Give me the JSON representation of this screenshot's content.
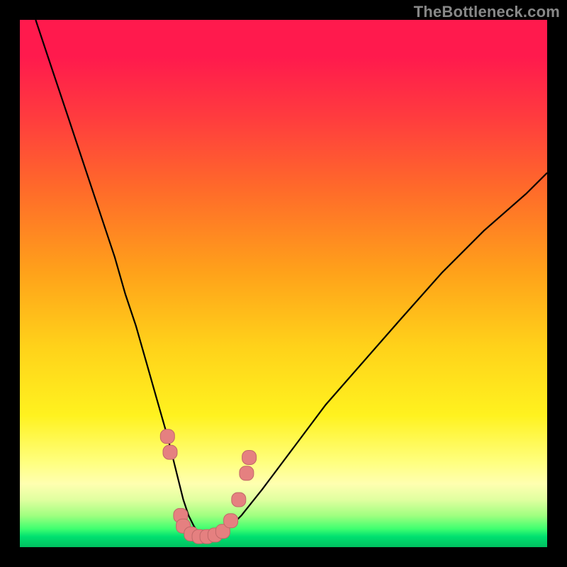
{
  "watermark": "TheBottleneck.com",
  "colors": {
    "black": "#000000",
    "curve": "#000000",
    "marker_fill": "#e58080",
    "marker_stroke": "#c06868"
  },
  "chart_data": {
    "type": "line",
    "title": "",
    "xlabel": "",
    "ylabel": "",
    "xlim": [
      0,
      100
    ],
    "ylim": [
      0,
      100
    ],
    "grid": false,
    "legend": false,
    "series": [
      {
        "name": "bottleneck-curve",
        "x": [
          3,
          6,
          9,
          12,
          15,
          18,
          20,
          22,
          24,
          26,
          28,
          29,
          30,
          31,
          32,
          33,
          34,
          35,
          36,
          37,
          39,
          42,
          46,
          52,
          58,
          65,
          72,
          80,
          88,
          96,
          100
        ],
        "y": [
          100,
          91,
          82,
          73,
          64,
          55,
          48,
          42,
          35,
          28,
          21,
          17,
          13,
          9,
          6,
          4,
          2.5,
          2,
          2,
          2.2,
          3,
          6,
          11,
          19,
          27,
          35,
          43,
          52,
          60,
          67,
          71
        ]
      }
    ],
    "markers": [
      {
        "x": 28.0,
        "y": 21.0
      },
      {
        "x": 28.5,
        "y": 18.0
      },
      {
        "x": 30.5,
        "y": 6.0
      },
      {
        "x": 31.0,
        "y": 4.0
      },
      {
        "x": 32.5,
        "y": 2.5
      },
      {
        "x": 34.0,
        "y": 2.0
      },
      {
        "x": 35.5,
        "y": 2.0
      },
      {
        "x": 37.0,
        "y": 2.3
      },
      {
        "x": 38.5,
        "y": 3.0
      },
      {
        "x": 40.0,
        "y": 5.0
      },
      {
        "x": 41.5,
        "y": 9.0
      },
      {
        "x": 43.0,
        "y": 14.0
      },
      {
        "x": 43.5,
        "y": 17.0
      }
    ]
  }
}
